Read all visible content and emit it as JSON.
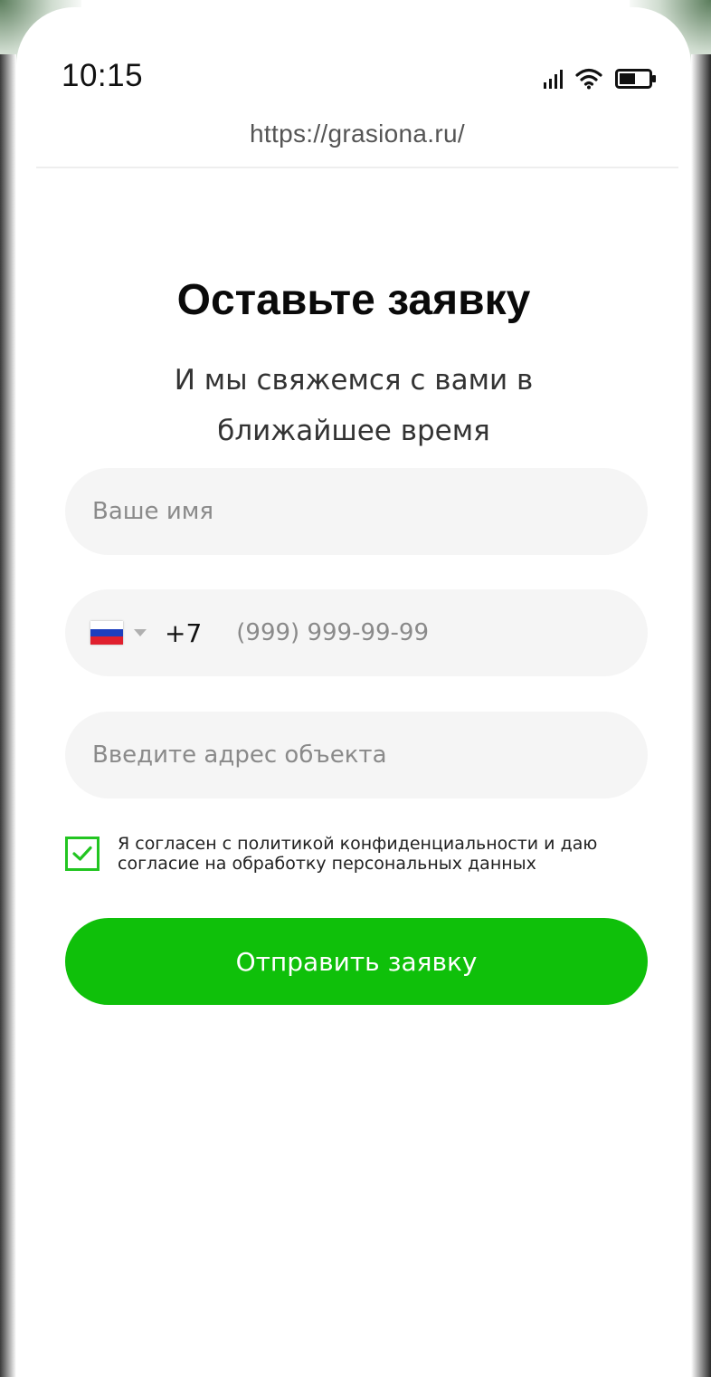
{
  "status_bar": {
    "time": "10:15",
    "icons": [
      "signal-icon",
      "wifi-icon",
      "battery-icon"
    ]
  },
  "browser": {
    "url": "https://grasiona.ru/"
  },
  "form": {
    "title": "Оставьте заявку",
    "subtitle": "И мы свяжемся с вами в ближайшее время",
    "name_placeholder": "Ваше имя",
    "phone": {
      "country_flag": "ru-flag-icon",
      "dial_code": "+7",
      "placeholder": "(999) 999-99-99"
    },
    "address_placeholder": "Введите адрес объекта",
    "consent": {
      "checked": true,
      "text": "Я согласен с политикой конфиденциальности и даю согласие на обработку персональных данных"
    },
    "submit_label": "Отправить заявку"
  },
  "colors": {
    "accent": "#0fc00a",
    "checkbox_border": "#22c521",
    "field_background": "#f5f5f5"
  }
}
